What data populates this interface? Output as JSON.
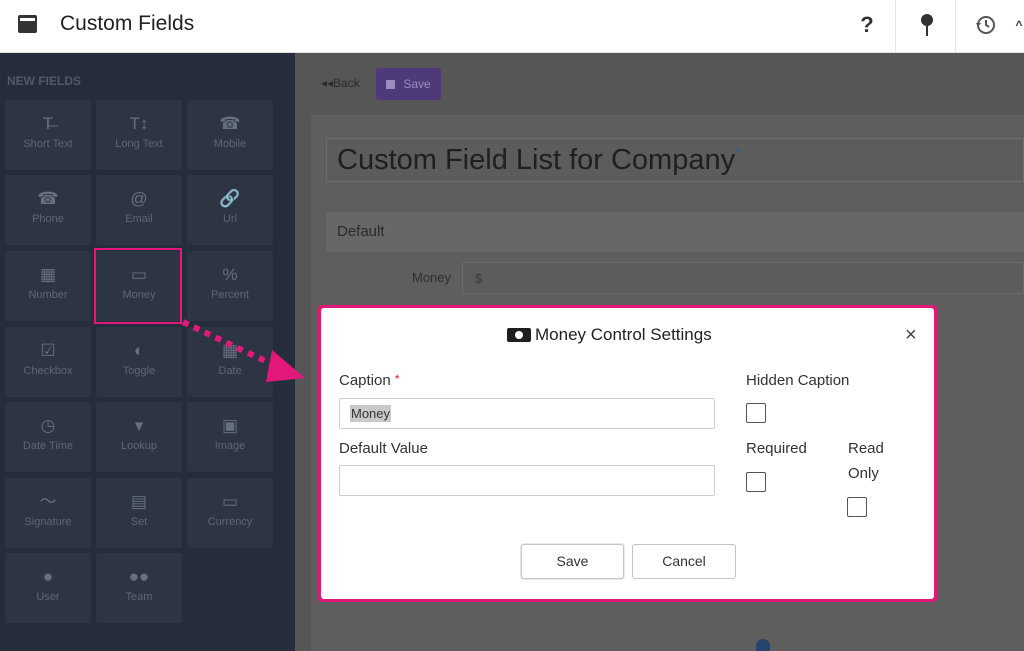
{
  "header": {
    "title": "Custom Fields",
    "icons": [
      "app-window-icon",
      "help-icon",
      "pin-icon",
      "history-icon"
    ]
  },
  "sidebar": {
    "heading": "NEW FIELDS",
    "tiles": [
      {
        "label": "Short Text",
        "icon": "short-text-icon",
        "glyph": "T̶"
      },
      {
        "label": "Long Text",
        "icon": "long-text-icon",
        "glyph": "T↕"
      },
      {
        "label": "Mobile",
        "icon": "mobile-icon",
        "glyph": "☎"
      },
      {
        "label": "Phone",
        "icon": "phone-icon",
        "glyph": "☎"
      },
      {
        "label": "Email",
        "icon": "email-icon",
        "glyph": "@"
      },
      {
        "label": "Url",
        "icon": "link-icon",
        "glyph": "🔗"
      },
      {
        "label": "Number",
        "icon": "calculator-icon",
        "glyph": "▦"
      },
      {
        "label": "Money",
        "icon": "money-icon",
        "glyph": "▭"
      },
      {
        "label": "Percent",
        "icon": "percent-icon",
        "glyph": "%"
      },
      {
        "label": "Checkbox",
        "icon": "checkbox-icon",
        "glyph": "☑"
      },
      {
        "label": "Toggle",
        "icon": "toggle-icon",
        "glyph": "◐"
      },
      {
        "label": "Date",
        "icon": "calendar-icon",
        "glyph": "▦"
      },
      {
        "label": "Date Time",
        "icon": "clock-icon",
        "glyph": "◷"
      },
      {
        "label": "Lookup",
        "icon": "lookup-icon",
        "glyph": "▾"
      },
      {
        "label": "Image",
        "icon": "image-icon",
        "glyph": "▣"
      },
      {
        "label": "Signature",
        "icon": "signature-icon",
        "glyph": "〜"
      },
      {
        "label": "Set",
        "icon": "set-icon",
        "glyph": "▤"
      },
      {
        "label": "Currency",
        "icon": "currency-icon",
        "glyph": "▭"
      },
      {
        "label": "User",
        "icon": "user-icon",
        "glyph": "●"
      },
      {
        "label": "Team",
        "icon": "team-icon",
        "glyph": "●●"
      }
    ]
  },
  "toolbar": {
    "back_label": "◂◂Back",
    "save_label": "Save"
  },
  "main": {
    "page_title": "Custom Field List for Company",
    "section_label": "Default",
    "money_field_label": "Money",
    "money_field_prefix": "$"
  },
  "modal": {
    "title": "Money Control Settings",
    "close": "×",
    "caption_label": "Caption",
    "caption_required": "*",
    "caption_value": "Money",
    "default_value_label": "Default Value",
    "default_value": "",
    "hidden_caption_label": "Hidden Caption",
    "required_label": "Required",
    "read_only_label_1": "Read",
    "read_only_label_2": "Only",
    "save_label": "Save",
    "cancel_label": "Cancel",
    "hidden_caption_checked": false,
    "required_checked": false,
    "read_only_checked": false
  },
  "colors": {
    "annotation": "#e2197b",
    "sidebar_bg": "#262d3a",
    "save_button": "#4e3a78"
  }
}
